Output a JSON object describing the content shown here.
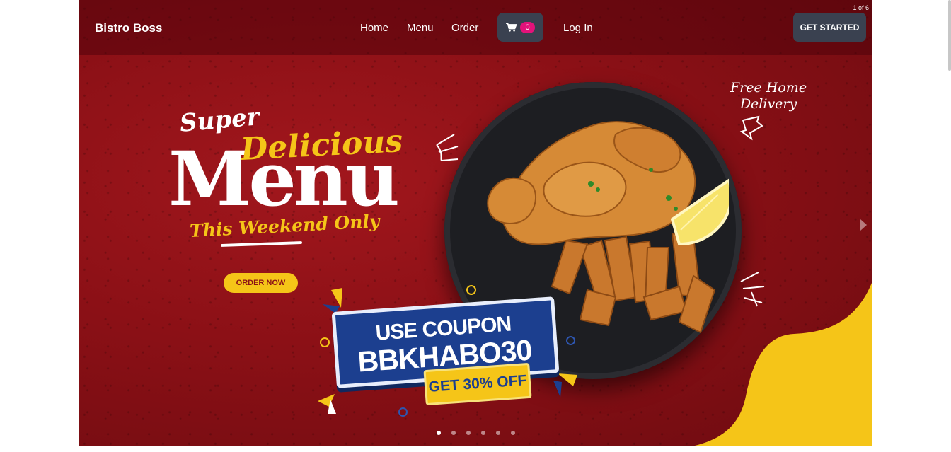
{
  "navbar": {
    "brand": "Bistro Boss",
    "links": [
      "Home",
      "Menu",
      "Order",
      "Log In"
    ],
    "cart_count": "0",
    "cta": "GET STARTED"
  },
  "carousel": {
    "counter": "1 of 6",
    "active_index": 0,
    "total": 6
  },
  "hero": {
    "super": "Super",
    "delicious": "Delicious",
    "menu": "Menu",
    "weekend": "This Weekend Only",
    "order_button": "ORDER NOW",
    "delivery_line1": "Free Home",
    "delivery_line2": "Delivery",
    "coupon_line1": "USE COUPON",
    "coupon_code": "BBKHABO30",
    "coupon_offer": "GET 30% OFF"
  },
  "colors": {
    "banner_red": "#8e1118",
    "accent_yellow": "#f5c518",
    "coupon_blue": "#1c3f8f",
    "button_dark": "#3a4150",
    "badge_pink": "#e3127a"
  },
  "icons": [
    "cart-icon",
    "chevron-right-icon"
  ]
}
